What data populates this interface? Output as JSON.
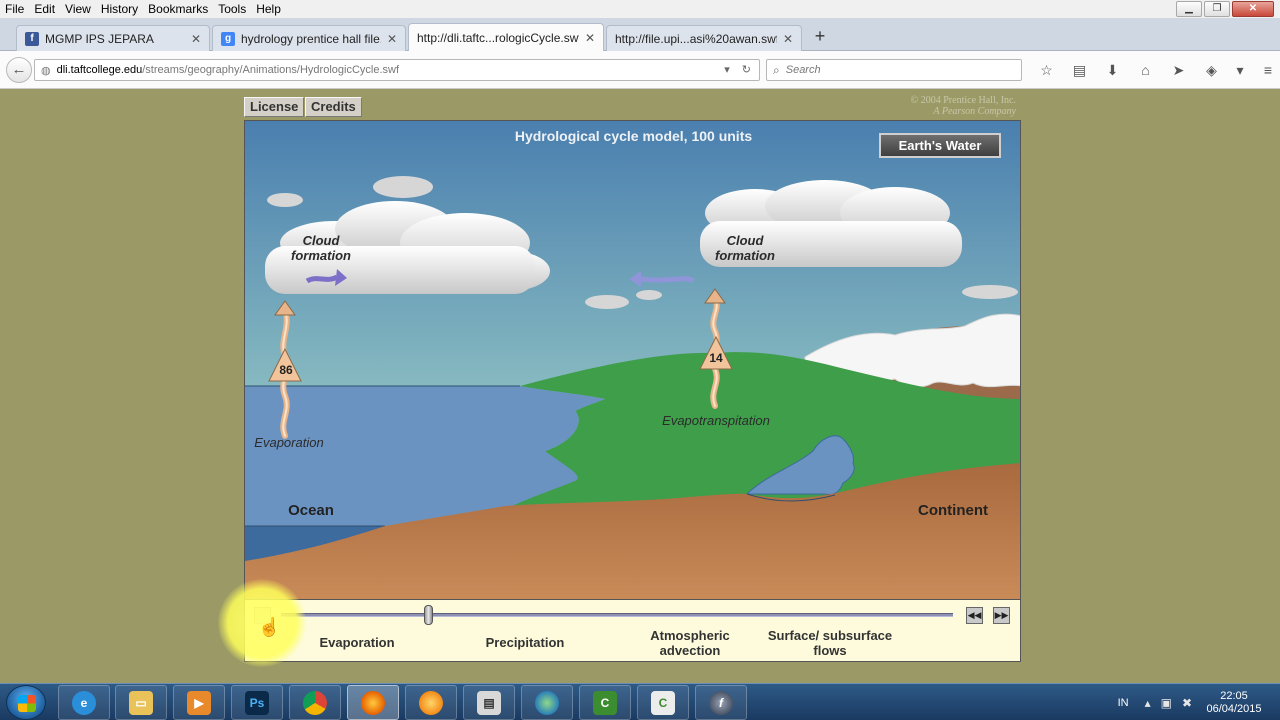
{
  "menubar": {
    "items": [
      "File",
      "Edit",
      "View",
      "History",
      "Bookmarks",
      "Tools",
      "Help"
    ]
  },
  "tabs": [
    {
      "title": "MGMP IPS JEPARA",
      "icon": "f",
      "icon_color": "#3b5998"
    },
    {
      "title": "hydrology prentice hall file...",
      "icon": "g",
      "icon_color": "#4285f4"
    },
    {
      "title": "http://dli.taftc...rologicCycle.swf",
      "icon": "",
      "icon_color": "#fbfbfb"
    },
    {
      "title": "http://file.upi...asi%20awan.swf",
      "icon": "",
      "icon_color": "#dde3ec"
    }
  ],
  "urlbar": {
    "domain": "dli.taftcollege.edu",
    "path": "/streams/geography/Animations/HydrologicCycle.swf"
  },
  "search": {
    "placeholder": "Search"
  },
  "content": {
    "license_label": "License",
    "credits_label": "Credits",
    "copyright_line1": "© 2004 Prentice Hall, Inc.",
    "copyright_line2": "A Pearson Company"
  },
  "scene": {
    "title": "Hydrological cycle model, 100 units",
    "earth_water_button": "Earth's Water",
    "cloud_label_left": "Cloud formation",
    "cloud_label_right": "Cloud formation",
    "evaporation_value": "86",
    "evapotranspiration_value": "14",
    "evaporation_label": "Evaporation",
    "evapotranspiration_label": "Evapotranspitation",
    "ocean_label": "Ocean",
    "continent_label": "Continent"
  },
  "controls": {
    "step1": "Evaporation",
    "step2": "Precipitation",
    "step3": "Atmospheric advection",
    "step4": "Surface/ subsurface flows",
    "progress": 0.22
  },
  "taskbar": {
    "lang": "IN",
    "time": "22:05",
    "date": "06/04/2015"
  }
}
